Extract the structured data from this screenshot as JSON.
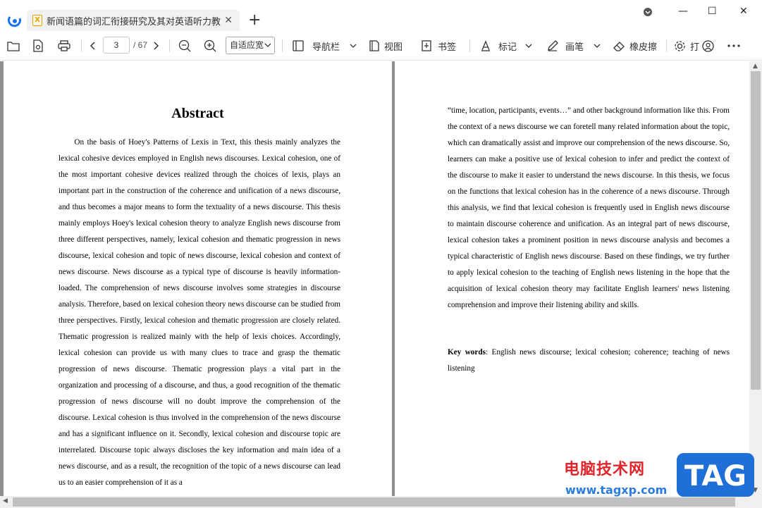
{
  "tab": {
    "title": "新闻语篇的词汇衔接研究及其对英语听力教..."
  },
  "toolbar": {
    "page_current": "3",
    "page_total": "/ 67",
    "zoom_value": "自适应宽",
    "nav_label": "导航栏",
    "view_label": "视图",
    "bookmark_label": "书签",
    "mark_label": "标记",
    "brush_label": "画笔",
    "eraser_label": "橡皮擦",
    "settings_label": "打"
  },
  "document": {
    "left_page": {
      "title": "Abstract",
      "paragraph": "On the basis of Hoey's Patterns of Lexis in Text, this thesis mainly analyzes the lexical cohesive devices employed in English news discourses. Lexical cohesion, one of the most important cohesive devices realized through the choices of lexis, plays an important part in the construction of the coherence and unification of a news discourse, and thus becomes a major means to form the textuality of a news discourse. This thesis mainly employs Hoey's lexical cohesion theory to analyze English news discourse from three different perspectives, namely, lexical cohesion and thematic progression in news discourse, lexical cohesion and topic of news discourse, lexical cohesion and context of news discourse. News discourse as a typical type of discourse is heavily information-loaded. The comprehension of news discourse involves some strategies in discourse analysis. Therefore, based on lexical cohesion theory news discourse can be studied from three perspectives. Firstly, lexical cohesion and thematic progression are closely related. Thematic progression is realized mainly with the help of lexis choices. Accordingly, lexical cohesion can provide us with many clues to trace and grasp the thematic progression of news discourse. Thematic progression plays a vital part in the organization and processing of a discourse, and thus, a good recognition of the thematic progression of news discourse will no doubt improve the comprehension of the discourse. Lexical cohesion is thus involved in the comprehension of the news discourse and has a significant influence on it. Secondly, lexical cohesion and discourse topic are interrelated. Discourse topic always discloses the key information and main idea of a news discourse, and as a result, the recognition of the topic of a news discourse can lead us to an easier comprehension of it as a"
    },
    "right_page": {
      "paragraph": "“time, location, participants, events…” and other background information like this. From the context of a news discourse we can foretell many related information about the topic, which can dramatically assist and improve our comprehension of the news discourse. So, learners can make a positive use of lexical cohesion to infer and predict the context of the discourse to make it easier to understand the news discourse. In this thesis, we focus on the functions that lexical cohesion has in the coherence of a news discourse. Through this analysis, we find that lexical cohesion is frequently used in English news discourse to maintain discourse coherence and unification. As an integral part of news discourse, lexical cohesion takes a prominent position in news discourse analysis and becomes a typical characteristic of English news discourse. Based on these findings, we try further to apply lexical cohesion to the teaching of English news listening in the hope that the acquisition of lexical cohesion theory may facilitate English learners' news listening comprehension and improve their listening ability and skills.",
      "keywords_label": "Key words",
      "keywords": ": English news discourse; lexical cohesion; coherence; teaching of news listening"
    }
  },
  "watermark": {
    "site_name": "电脑技术网",
    "url": "www.tagxp.com",
    "badge": "TAG"
  }
}
